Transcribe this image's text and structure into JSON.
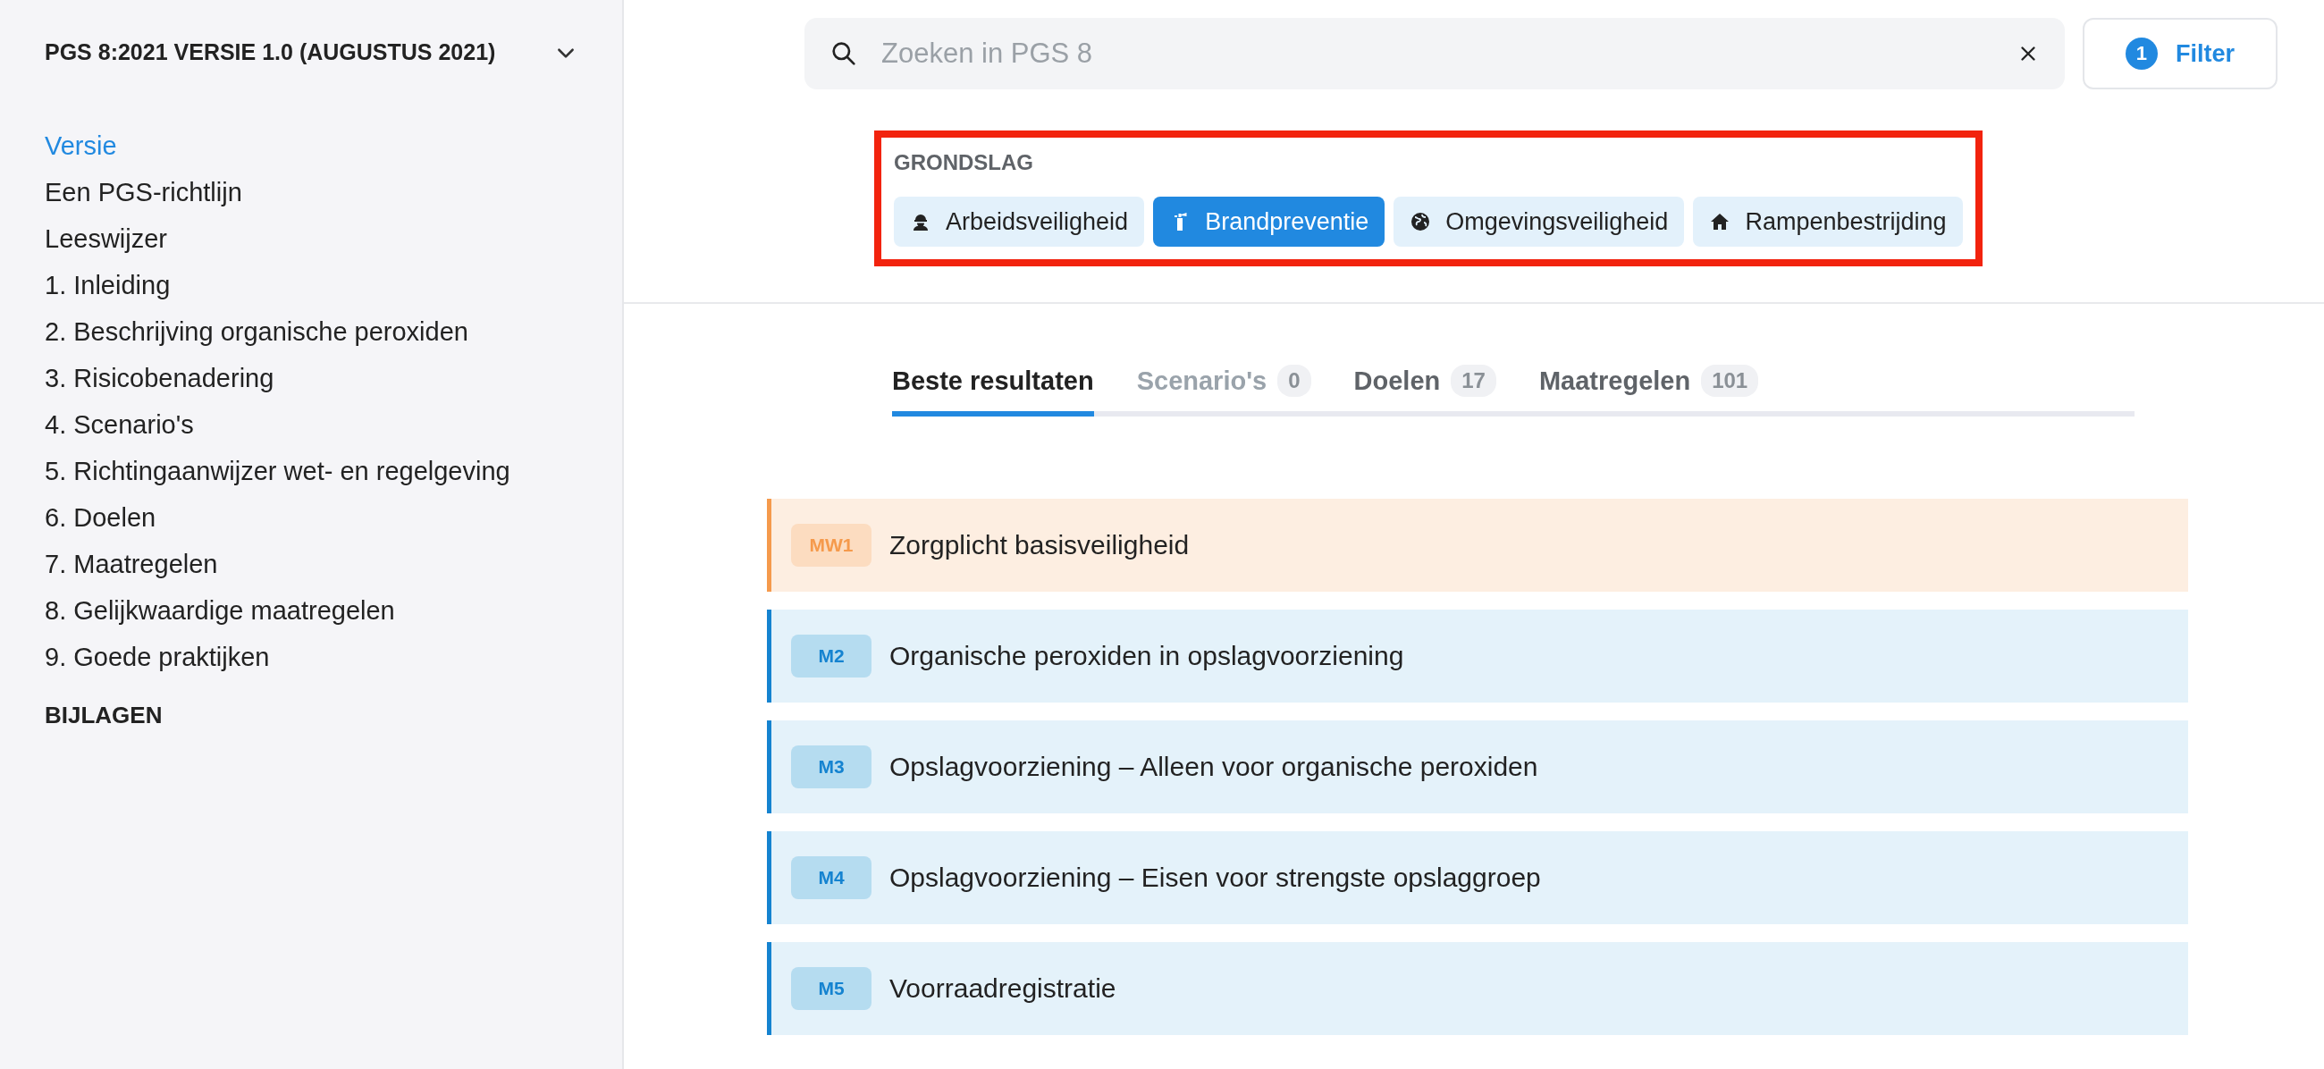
{
  "sidebar": {
    "title": "PGS 8:2021 VERSIE 1.0 (AUGUSTUS 2021)",
    "items": [
      {
        "label": "Versie",
        "selected": true
      },
      {
        "label": "Een PGS-richtlijn",
        "selected": false
      },
      {
        "label": "Leeswijzer",
        "selected": false
      },
      {
        "label": "1. Inleiding",
        "selected": false
      },
      {
        "label": "2. Beschrijving organische peroxiden",
        "selected": false
      },
      {
        "label": "3. Risicobenadering",
        "selected": false
      },
      {
        "label": "4. Scenario's",
        "selected": false
      },
      {
        "label": "5. Richtingaanwijzer wet- en regelgeving",
        "selected": false
      },
      {
        "label": "6. Doelen",
        "selected": false
      },
      {
        "label": "7. Maatregelen",
        "selected": false
      },
      {
        "label": "8. Gelijkwaardige maatregelen",
        "selected": false
      },
      {
        "label": "9. Goede praktijken",
        "selected": false
      }
    ],
    "section": "BIJLAGEN"
  },
  "search": {
    "placeholder": "Zoeken in PGS 8"
  },
  "filter_button": {
    "count": "1",
    "label": "Filter"
  },
  "grondslag": {
    "title": "GRONDSLAG",
    "highlighted": true,
    "chips": [
      {
        "label": "Arbeidsveiligheid",
        "kind": "worker",
        "selected": false
      },
      {
        "label": "Brandpreventie",
        "kind": "extinguisher",
        "selected": true
      },
      {
        "label": "Omgevingsveiligheid",
        "kind": "globe",
        "selected": false
      },
      {
        "label": "Rampenbestrijding",
        "kind": "house",
        "selected": false
      }
    ]
  },
  "tabs": [
    {
      "label": "Beste resultaten",
      "selected": true,
      "disabled": false
    },
    {
      "label": "Scenario's",
      "count": "0",
      "selected": false,
      "disabled": true
    },
    {
      "label": "Doelen",
      "count": "17",
      "selected": false,
      "disabled": false
    },
    {
      "label": "Maatregelen",
      "count": "101",
      "selected": false,
      "disabled": false
    }
  ],
  "results": [
    {
      "code": "MW1",
      "title": "Zorgplicht basisveiligheid",
      "kind": "mw"
    },
    {
      "code": "M2",
      "title": "Organische peroxiden in opslagvoorziening",
      "kind": "m"
    },
    {
      "code": "M3",
      "title": "Opslagvoorziening – Alleen voor organische peroxiden",
      "kind": "m"
    },
    {
      "code": "M4",
      "title": "Opslagvoorziening – Eisen voor strengste opslaggroep",
      "kind": "m"
    },
    {
      "code": "M5",
      "title": "Voorraadregistratie",
      "kind": "m"
    }
  ]
}
